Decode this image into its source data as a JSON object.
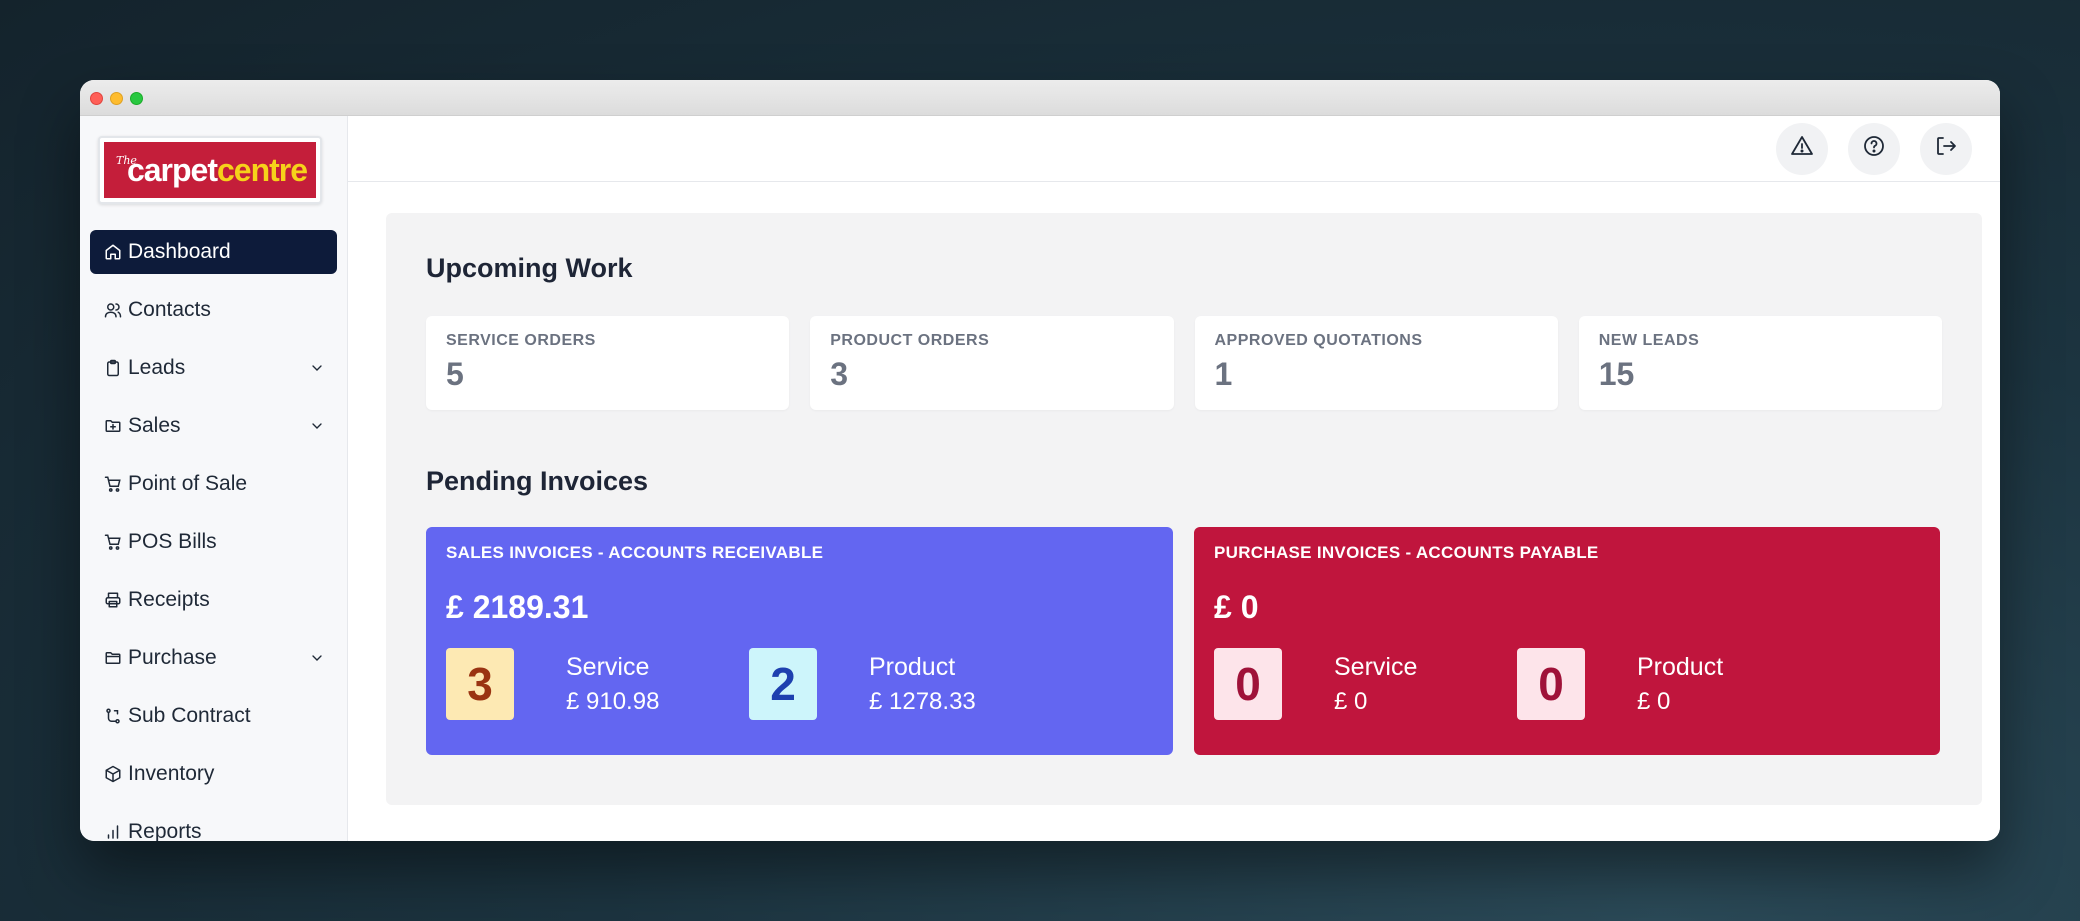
{
  "logo": {
    "the": "The",
    "carpet": "carpet",
    "centre": "centre"
  },
  "sidebar": {
    "items": [
      {
        "label": "Dashboard",
        "icon": "home-icon"
      },
      {
        "label": "Contacts",
        "icon": "users-icon"
      },
      {
        "label": "Leads",
        "icon": "clipboard-icon"
      },
      {
        "label": "Sales",
        "icon": "folder-plus-icon"
      },
      {
        "label": "Point of Sale",
        "icon": "cart-icon"
      },
      {
        "label": "POS Bills",
        "icon": "cart-icon"
      },
      {
        "label": "Receipts",
        "icon": "printer-icon"
      },
      {
        "label": "Purchase",
        "icon": "folder-icon"
      },
      {
        "label": "Sub Contract",
        "icon": "route-icon"
      },
      {
        "label": "Inventory",
        "icon": "box-icon"
      },
      {
        "label": "Reports",
        "icon": "bar-chart-icon"
      }
    ]
  },
  "upcoming": {
    "title": "Upcoming Work",
    "stats": [
      {
        "label": "SERVICE ORDERS",
        "value": "5"
      },
      {
        "label": "PRODUCT ORDERS",
        "value": "3"
      },
      {
        "label": "APPROVED QUOTATIONS",
        "value": "1"
      },
      {
        "label": "NEW LEADS",
        "value": "15"
      }
    ]
  },
  "pending": {
    "title": "Pending Invoices",
    "sales": {
      "title": "SALES INVOICES - ACCOUNTS RECEIVABLE",
      "total": "£ 2189.31",
      "service": {
        "count": "3",
        "label": "Service",
        "amount": "£ 910.98"
      },
      "product": {
        "count": "2",
        "label": "Product",
        "amount": "£ 1278.33"
      }
    },
    "purchase": {
      "title": "PURCHASE INVOICES - ACCOUNTS PAYABLE",
      "total": "£ 0",
      "service": {
        "count": "0",
        "label": "Service",
        "amount": "£ 0"
      },
      "product": {
        "count": "0",
        "label": "Product",
        "amount": "£ 0"
      }
    }
  },
  "colors": {
    "sales_card": "#6366f1",
    "purchase_card": "#c0153d",
    "active_nav": "#0d1b3a"
  }
}
